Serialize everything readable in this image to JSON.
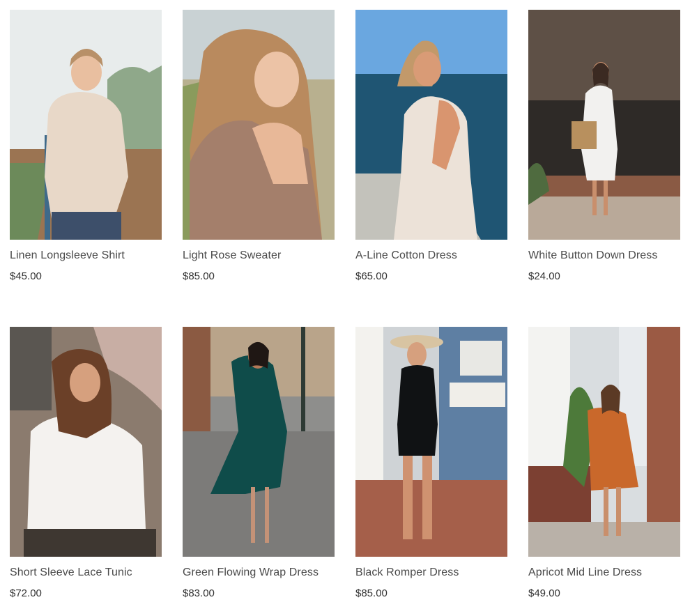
{
  "products": [
    {
      "name": "Linen Longsleeve Shirt",
      "price": "$45.00"
    },
    {
      "name": "Light Rose Sweater",
      "price": "$85.00"
    },
    {
      "name": "A-Line Cotton Dress",
      "price": "$65.00"
    },
    {
      "name": "White Button Down Dress",
      "price": "$24.00"
    },
    {
      "name": "Short Sleeve Lace Tunic",
      "price": "$72.00"
    },
    {
      "name": "Green Flowing Wrap Dress",
      "price": "$83.00"
    },
    {
      "name": "Black Romper Dress",
      "price": "$85.00"
    },
    {
      "name": "Apricot Mid Line Dress",
      "price": "$49.00"
    }
  ]
}
